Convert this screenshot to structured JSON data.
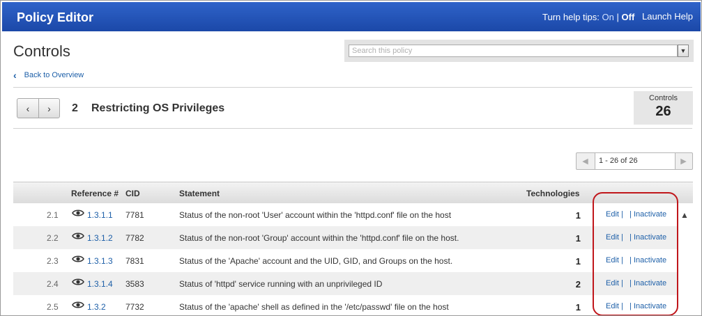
{
  "header": {
    "app_title": "Policy Editor",
    "help_tips_label": "Turn help tips:",
    "help_on": "On",
    "help_sep": "|",
    "help_off": "Off",
    "launch_help": "Launch Help"
  },
  "page": {
    "title": "Controls",
    "search_placeholder": "Search this policy",
    "back_link": "Back to Overview"
  },
  "section": {
    "number": "2",
    "title": "Restricting OS Privileges",
    "controls_label": "Controls",
    "controls_count": "26",
    "prev_icon": "chevron-left-icon",
    "next_icon": "chevron-right-icon"
  },
  "pager": {
    "range": "1 - 26 of 26"
  },
  "table": {
    "columns": {
      "reference": "Reference #",
      "cid": "CID",
      "statement": "Statement",
      "technologies": "Technologies"
    },
    "rows": [
      {
        "num": "2.1",
        "ref": "1.3.1.1",
        "cid": "7781",
        "statement": "Status of the non-root 'User' account within the 'httpd.conf' file on the host",
        "tech": "1"
      },
      {
        "num": "2.2",
        "ref": "1.3.1.2",
        "cid": "7782",
        "statement": "Status of the non-root 'Group' account within the 'httpd.conf' file on the host.",
        "tech": "1"
      },
      {
        "num": "2.3",
        "ref": "1.3.1.3",
        "cid": "7831",
        "statement": "Status of the 'Apache' account and the UID, GID, and Groups on the host.",
        "tech": "1"
      },
      {
        "num": "2.4",
        "ref": "1.3.1.4",
        "cid": "3583",
        "statement": "Status of 'httpd' service running with an unprivileged ID",
        "tech": "2"
      },
      {
        "num": "2.5",
        "ref": "1.3.2",
        "cid": "7732",
        "statement": "Status of the 'apache' shell as defined in the '/etc/passwd' file on the host",
        "tech": "1"
      }
    ],
    "actions": {
      "edit": "Edit",
      "sep1": "|",
      "sep2": "|",
      "inactivate": "Inactivate"
    }
  },
  "colors": {
    "header_blue": "#2456bd",
    "link_blue": "#1d5fa8",
    "highlight_red": "#c0161b"
  }
}
